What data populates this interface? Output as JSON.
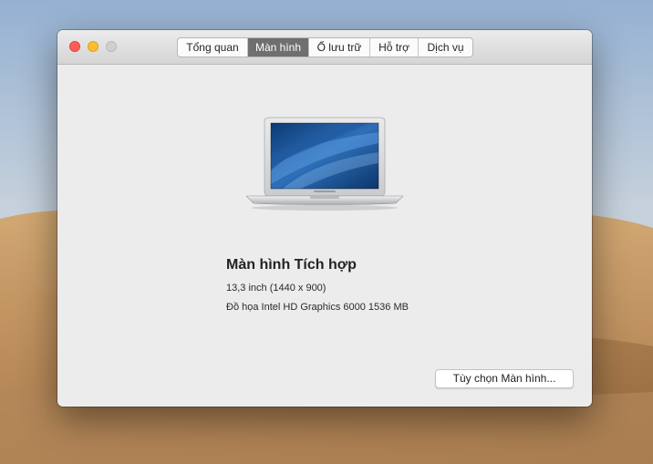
{
  "window": {
    "tabs": [
      {
        "label": "Tổng quan",
        "active": false
      },
      {
        "label": "Màn hình",
        "active": true
      },
      {
        "label": "Ổ lưu trữ",
        "active": false
      },
      {
        "label": "Hỗ trợ",
        "active": false
      },
      {
        "label": "Dịch vụ",
        "active": false
      }
    ]
  },
  "display": {
    "name": "Màn hình Tích hợp",
    "resolution": "13,3 inch (1440 x 900)",
    "graphics": "Đồ họa Intel HD Graphics 6000 1536 MB",
    "options_button": "Tùy chọn Màn hình..."
  },
  "colors": {
    "close": "#fe5f57",
    "minimize": "#febc2e",
    "zoom": "#cfcfcf",
    "active_tab": "#6f6f6f"
  },
  "icons": {
    "device": "macbook-air-icon"
  }
}
